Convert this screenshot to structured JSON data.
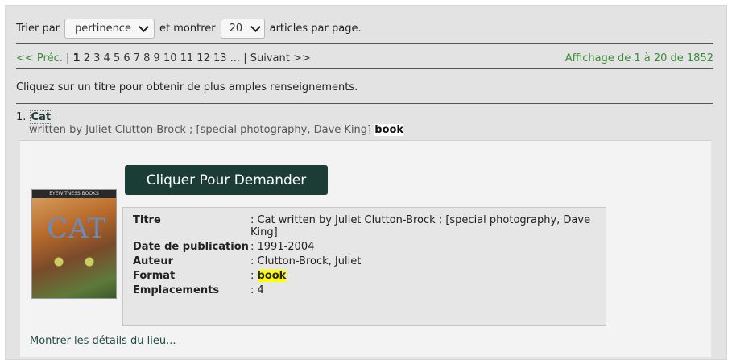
{
  "sort": {
    "prefix": "Trier par",
    "selected": "pertinence",
    "middle": "et montrer",
    "count": "20",
    "suffix": "articles par page."
  },
  "pager": {
    "prev": "<< Préc.",
    "sep1": "|",
    "current": "1",
    "pages": "2 3 4 5 6 7 8 9 10 11 12 13 ...",
    "sep2": "|",
    "next": "Suivant >>",
    "summary": "Affichage de 1 à 20 de 1852"
  },
  "instructions": "Cliquez sur un titre pour obtenir de plus amples renseignements.",
  "result": {
    "index": "1.",
    "title": "Cat",
    "byline": "written by Juliet Clutton-Brock ; [special photography, Dave King]",
    "format": "book",
    "request_button": "Cliquer Pour Demander",
    "cover_text": "CAT",
    "cover_band": "EYEWITNESS BOOKS",
    "fields": [
      {
        "key": "Titre",
        "value": ": Cat written by Juliet Clutton-Brock ; [special photography, Dave King]"
      },
      {
        "key": "Date de publication",
        "value": ": 1991-2004"
      },
      {
        "key": "Auteur",
        "value": ": Clutton-Brock, Juliet"
      },
      {
        "key": "Format",
        "sep": ": ",
        "value": "book"
      },
      {
        "key": "Emplacements",
        "value": ": 4"
      }
    ],
    "more_link": "Montrer les détails du lieu..."
  }
}
